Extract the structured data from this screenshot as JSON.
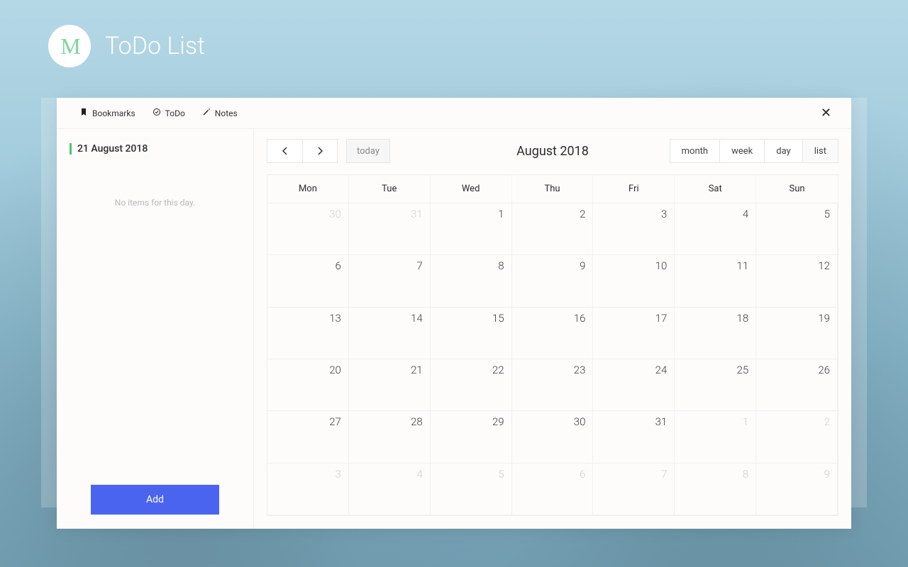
{
  "header": {
    "logo_text": "M",
    "title": "ToDo List"
  },
  "tabs": [
    {
      "icon": "bookmark-icon",
      "label": "Bookmarks"
    },
    {
      "icon": "check-icon",
      "label": "ToDo"
    },
    {
      "icon": "pencil-icon",
      "label": "Notes"
    }
  ],
  "sidebar": {
    "selected_date": "21 August 2018",
    "empty_text": "No items for this day.",
    "add_button": "Add"
  },
  "toolbar": {
    "today_label": "today",
    "month_title": "August 2018",
    "views": [
      "month",
      "week",
      "day",
      "list"
    ]
  },
  "calendar": {
    "dow": [
      "Mon",
      "Tue",
      "Wed",
      "Thu",
      "Fri",
      "Sat",
      "Sun"
    ],
    "weeks": [
      [
        {
          "d": 30,
          "other": true
        },
        {
          "d": 31,
          "other": true
        },
        {
          "d": 1
        },
        {
          "d": 2
        },
        {
          "d": 3
        },
        {
          "d": 4
        },
        {
          "d": 5
        }
      ],
      [
        {
          "d": 6
        },
        {
          "d": 7
        },
        {
          "d": 8
        },
        {
          "d": 9
        },
        {
          "d": 10
        },
        {
          "d": 11
        },
        {
          "d": 12
        }
      ],
      [
        {
          "d": 13
        },
        {
          "d": 14
        },
        {
          "d": 15
        },
        {
          "d": 16
        },
        {
          "d": 17
        },
        {
          "d": 18
        },
        {
          "d": 19
        }
      ],
      [
        {
          "d": 20
        },
        {
          "d": 21,
          "selected": true
        },
        {
          "d": 22
        },
        {
          "d": 23
        },
        {
          "d": 24
        },
        {
          "d": 25
        },
        {
          "d": 26
        }
      ],
      [
        {
          "d": 27
        },
        {
          "d": 28
        },
        {
          "d": 29
        },
        {
          "d": 30
        },
        {
          "d": 31
        },
        {
          "d": 1,
          "other": true
        },
        {
          "d": 2,
          "other": true
        }
      ],
      [
        {
          "d": 3,
          "other": true
        },
        {
          "d": 4,
          "other": true
        },
        {
          "d": 5,
          "other": true
        },
        {
          "d": 6,
          "other": true
        },
        {
          "d": 7,
          "other": true
        },
        {
          "d": 8,
          "other": true
        },
        {
          "d": 9,
          "other": true
        }
      ]
    ]
  }
}
